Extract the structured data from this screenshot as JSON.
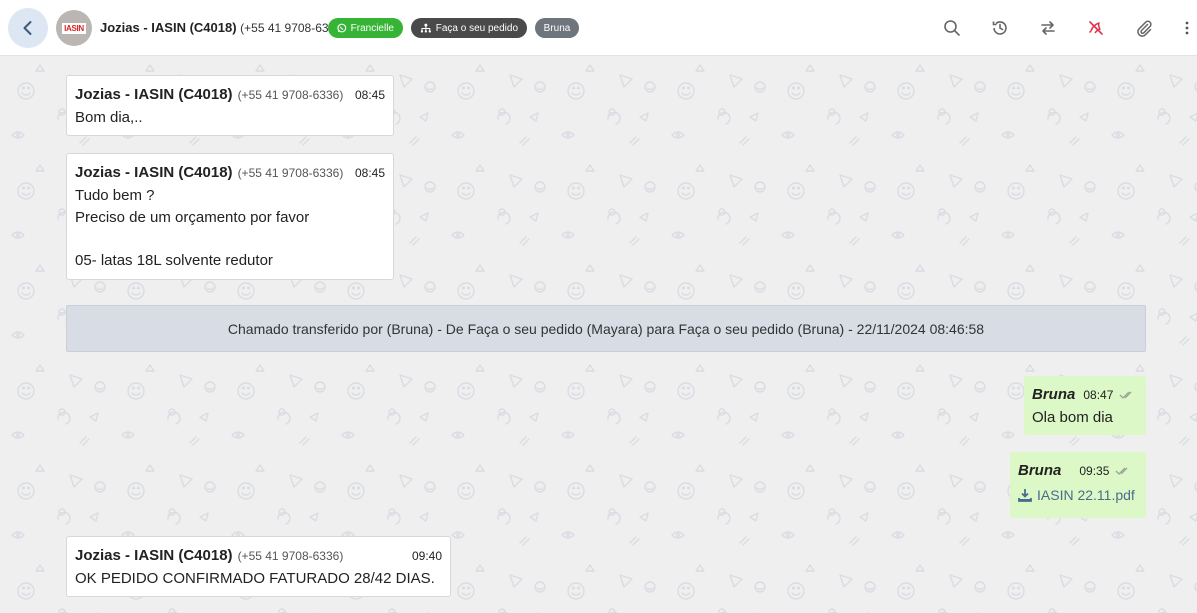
{
  "header": {
    "avatar_logo_text": "IASIN",
    "contact_name": "Jozias - IASIN (C4018)",
    "contact_phone": "(+55 41 9708-6336)",
    "tags": [
      {
        "label": "Francielle",
        "icon": "whatsapp-icon",
        "color": "#35b435"
      },
      {
        "label": "Faça o seu pedido",
        "icon": "department-icon",
        "color": "#4a4a4a"
      },
      {
        "label": "Bruna",
        "icon": "",
        "color": "#6f757c"
      }
    ],
    "actions": [
      "search-icon",
      "history-icon",
      "transfer-icon",
      "close-ticket-icon",
      "attach-icon",
      "more-icon"
    ]
  },
  "messages": [
    {
      "direction": "in",
      "sender": "Jozias - IASIN (C4018)",
      "phone": "(+55 41 9708-6336)",
      "time": "08:45",
      "text": "Bom dia,.."
    },
    {
      "direction": "in",
      "sender": "Jozias - IASIN (C4018)",
      "phone": "(+55 41 9708-6336)",
      "time": "08:45",
      "text": "Tudo bem ?\nPreciso de um orçamento por favor\n\n05- latas 18L solvente redutor"
    },
    {
      "direction": "system",
      "text": "Chamado transferido por (Bruna) - De Faça o seu pedido (Mayara) para Faça o seu pedido (Bruna) - 22/11/2024 08:46:58"
    },
    {
      "direction": "out",
      "sender": "Bruna",
      "time": "08:47",
      "text": "Ola bom dia"
    },
    {
      "direction": "out",
      "sender": "Bruna",
      "time": "09:35",
      "file": "IASIN 22.11.pdf"
    },
    {
      "direction": "in",
      "sender": "Jozias - IASIN (C4018)",
      "phone": "(+55 41 9708-6336)",
      "time": "09:40",
      "text": "OK PEDIDO CONFIRMADO FATURADO 28/42 DIAS."
    }
  ],
  "colors": {
    "incoming_bubble": "#ffffff",
    "outgoing_bubble": "#dcf8c6",
    "system_notice": "#d7dce5",
    "chat_background": "#efefef",
    "accent_red": "#e0334a"
  }
}
